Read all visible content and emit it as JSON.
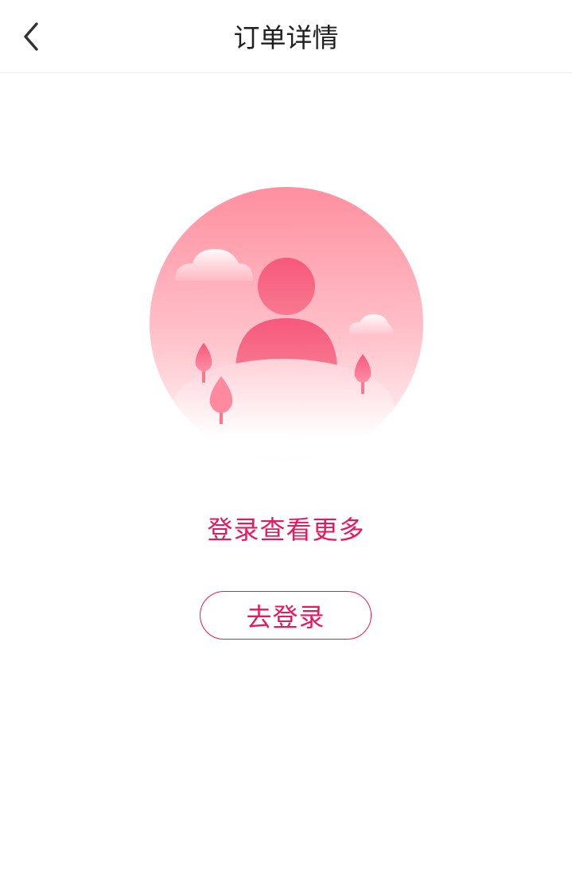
{
  "header": {
    "title": "订单详情",
    "back_icon": "chevron-left-icon"
  },
  "empty_state": {
    "illustration_icon": "user-avatar-landscape-icon",
    "message": "登录查看更多",
    "login_label": "去登录"
  },
  "colors": {
    "accent": "#e8185f",
    "title_text": "#1f1f1f",
    "illustration_pink": "#f7587c",
    "illustration_light": "#ffc6cf"
  }
}
